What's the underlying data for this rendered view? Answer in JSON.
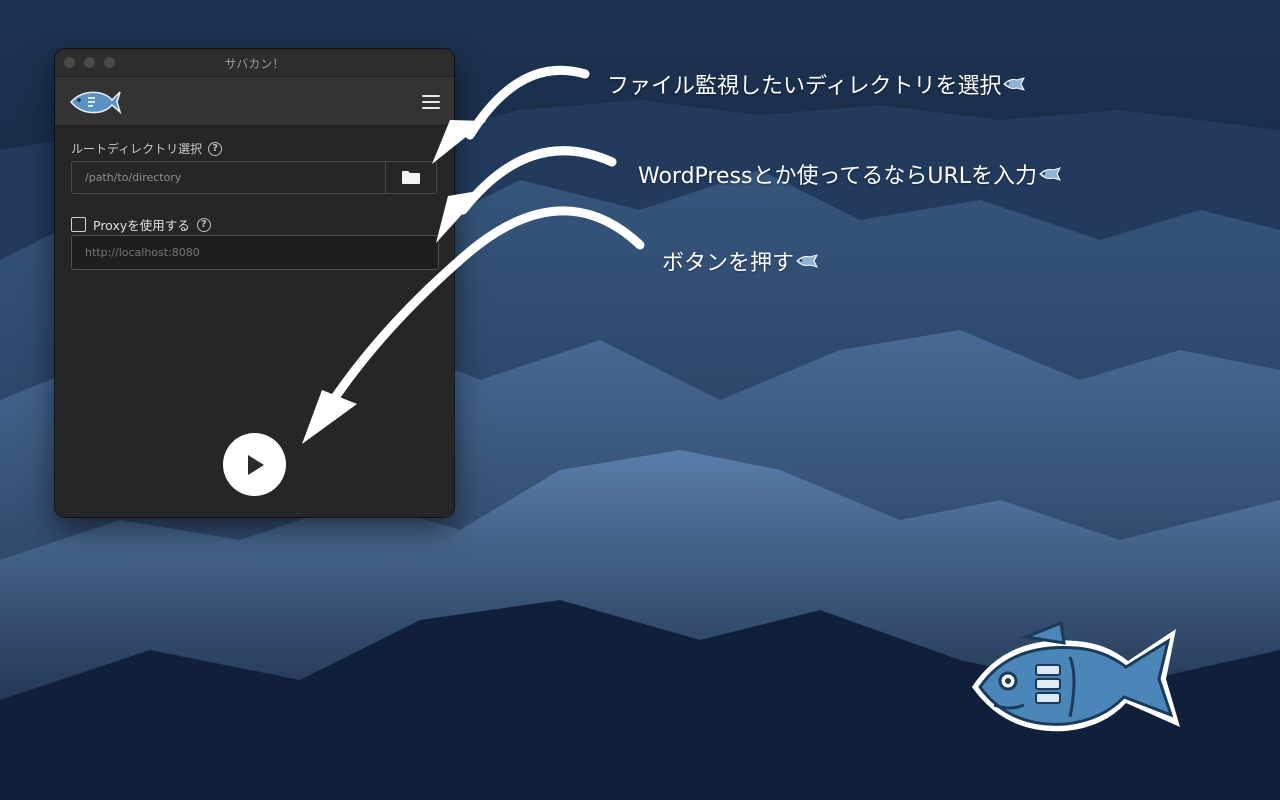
{
  "window": {
    "title": "サバカン！",
    "menu_icon": "hamburger-menu-icon"
  },
  "form": {
    "directory_label": "ルートディレクトリ選択",
    "directory_value": "/path/to/directory",
    "help_mark": "?",
    "folder_icon": "folder-icon",
    "proxy_checkbox_label": "Proxyを使用する",
    "proxy_checked": false,
    "proxy_placeholder": "http://localhost:8080",
    "play_icon": "play-icon"
  },
  "annotations": [
    {
      "text": "ファイル監視したいディレクトリを選択"
    },
    {
      "text": "WordPressとか使ってるならURLを入力"
    },
    {
      "text": "ボタンを押す"
    }
  ],
  "colors": {
    "window_bg": "#262626",
    "appbar_bg": "#333333",
    "fish_blue": "#4a86b8",
    "text_white": "#ffffff"
  }
}
